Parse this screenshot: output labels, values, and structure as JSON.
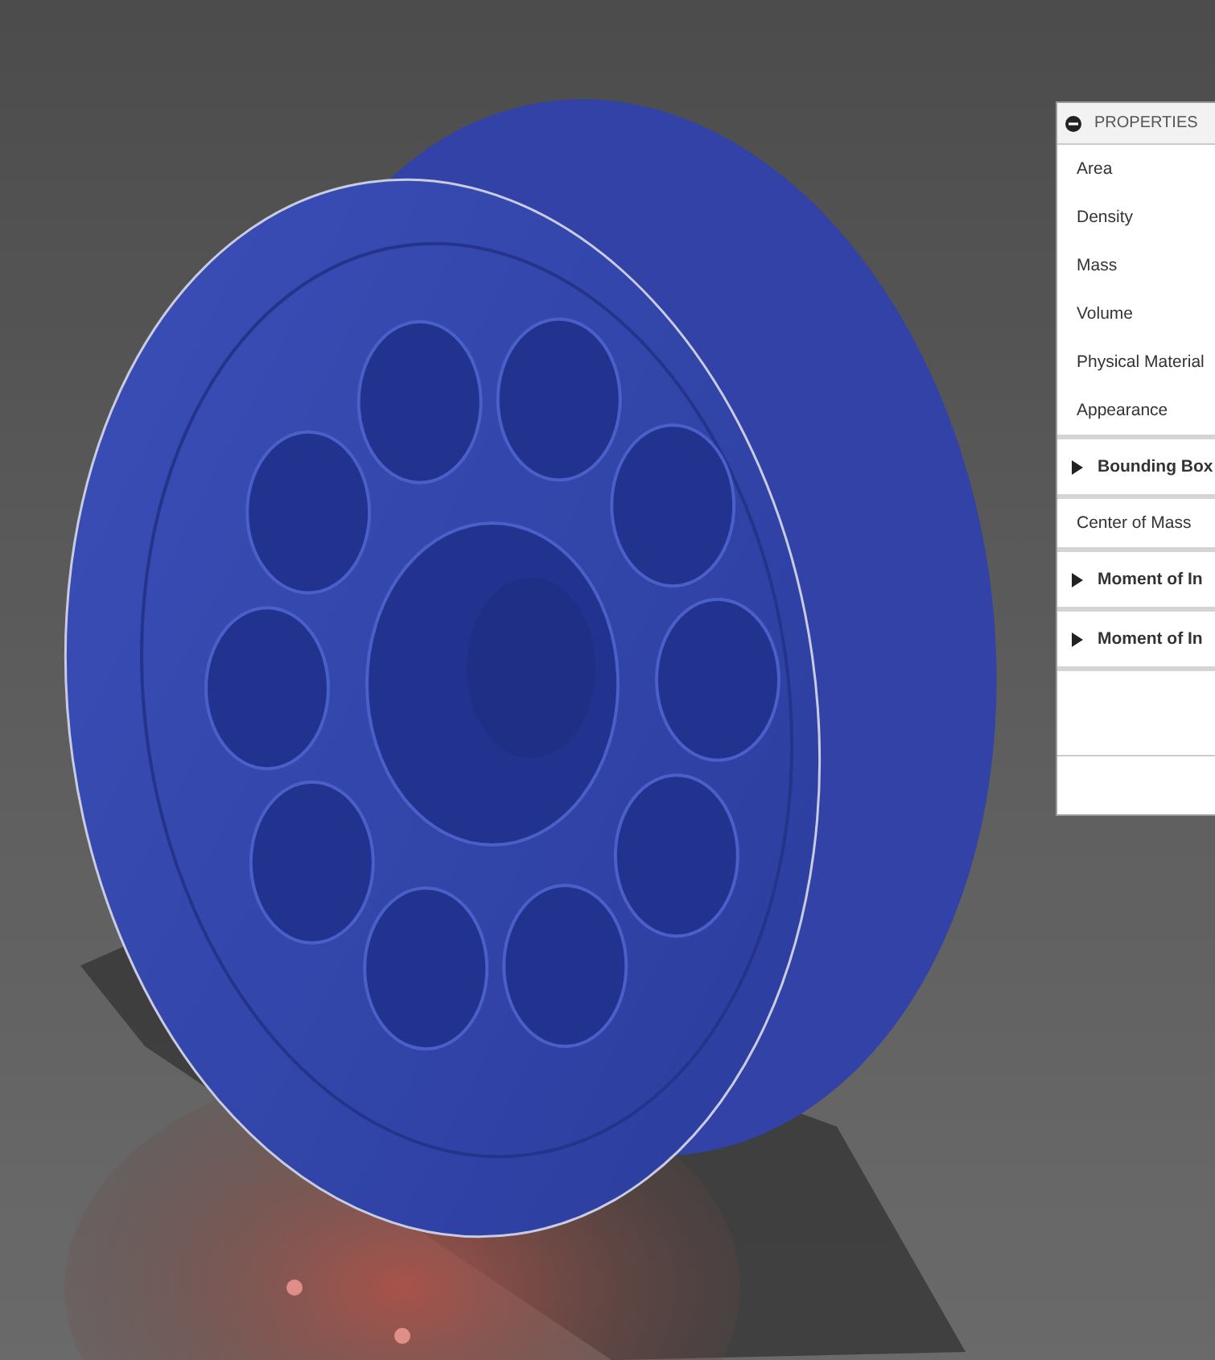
{
  "properties_panel": {
    "title": "PROPERTIES",
    "expanded": true,
    "rows": [
      {
        "kind": "field",
        "label": "Area"
      },
      {
        "kind": "field",
        "label": "Density"
      },
      {
        "kind": "field",
        "label": "Mass"
      },
      {
        "kind": "field",
        "label": "Volume"
      },
      {
        "kind": "field",
        "label": "Physical Material"
      },
      {
        "kind": "field",
        "label": "Appearance"
      },
      {
        "kind": "group",
        "label": "Bounding Box",
        "expanded": false
      },
      {
        "kind": "field",
        "label": "Center of Mass"
      },
      {
        "kind": "group",
        "label": "Moment of In",
        "expanded": false
      },
      {
        "kind": "group",
        "label": "Moment of In",
        "expanded": false
      }
    ]
  }
}
